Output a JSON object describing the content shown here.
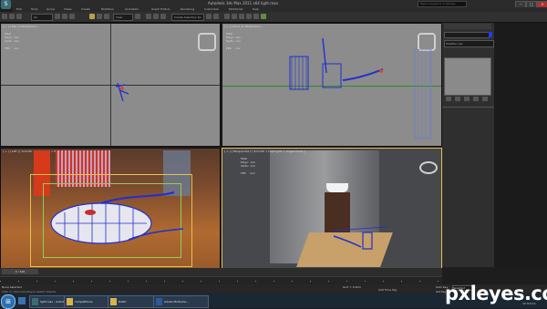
{
  "app": {
    "title": "Autodesk 3ds Max 2011 x64     light.max",
    "logo_letter": "S"
  },
  "search": {
    "placeholder": "Type a keyword or phrase"
  },
  "window_buttons": [
    "–",
    "□",
    "✕"
  ],
  "menus": [
    "Edit",
    "Tools",
    "Group",
    "Views",
    "Create",
    "Modifiers",
    "Animation",
    "Graph Editors",
    "Rendering",
    "Customize",
    "MAXScript",
    "Help"
  ],
  "toolbar": {
    "selection_filter": "All",
    "reference_coord": "View",
    "named_selection": "Create Selection Se"
  },
  "viewports": {
    "top": {
      "label": "[ + ] [ Top ] [ Wireframe ]",
      "stats": "Total\nPolys:  xxx\nVerts:  xxx\n\nFPS:    xxx"
    },
    "front": {
      "label": "[ + ] [ Front ] [ Wireframe ]",
      "stats": "Total\nPolys:  xxx\nVerts:  xxx\n\nFPS:    xxx"
    },
    "left": {
      "label": "[ + ] [ Left ] [ Smooth + Highlights + Edged Faces ]"
    },
    "perspective": {
      "label": "[ + ] [ Perspective ] [ Smooth + Highlights + Edged Faces ]",
      "stats": "Total\nPolys:  xxx\nVerts:  xxx\n\nFPS:    xxx"
    }
  },
  "command_panel": {
    "modifier_list": "Modifier List",
    "name_field": "ChamferBox"
  },
  "timeline": {
    "frame": "0 / 100"
  },
  "status": {
    "selection": "None Selected",
    "prompt": "Click or click-and-drag to select objects",
    "key_mode": "Selected",
    "set_key": "Set Key",
    "add_time_tag": "Add Time Tag",
    "grid": "Grid = 0.0cm",
    "auto_key": "Auto Key"
  },
  "taskbar": {
    "items": [
      "light.max - Autod...",
      "compétitions",
      "Public",
      "Adobe Photosho..."
    ],
    "clock": "12 Oct 11"
  },
  "watermark": "pxleyes.com",
  "colors": {
    "accent": "#e6c24a",
    "wireframe_blue": "#1f2fd0",
    "viewport_grey": "#8c8c8c"
  }
}
